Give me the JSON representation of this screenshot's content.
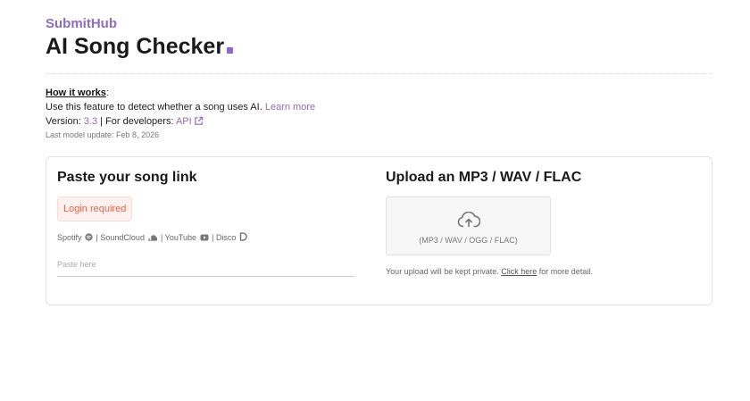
{
  "header": {
    "brand": "SubmitHub",
    "title": "AI Song Checker"
  },
  "info": {
    "how_label": "How it works",
    "how_suffix": ":",
    "description": "Use this feature to detect whether a song uses AI.",
    "learn_more": "Learn more",
    "version_label": "Version:",
    "version_value": "3.3",
    "developers_label": "| For developers:",
    "api_link": "API",
    "last_update": "Last model update: Feb 8, 2026"
  },
  "paste_section": {
    "heading": "Paste your song link",
    "login_required": "Login required",
    "platforms": [
      {
        "name": "Spotify",
        "icon": "spotify-icon"
      },
      {
        "name": "SoundCloud",
        "icon": "soundcloud-icon"
      },
      {
        "name": "YouTube",
        "icon": "youtube-icon"
      },
      {
        "name": "Disco",
        "icon": "disco-icon"
      }
    ],
    "separator": "|",
    "input_placeholder": "Paste here",
    "input_value": ""
  },
  "upload_section": {
    "heading": "Upload an MP3 / WAV / FLAC",
    "dropzone_formats": "(MP3 / WAV / OGG / FLAC)",
    "privacy_text": "Your upload will be kept private.",
    "privacy_link": "Click here",
    "privacy_suffix": "for more detail."
  },
  "colors": {
    "brand": "#8e6cbf",
    "login_text": "#e0654f",
    "login_bg": "#fdf1ef"
  }
}
